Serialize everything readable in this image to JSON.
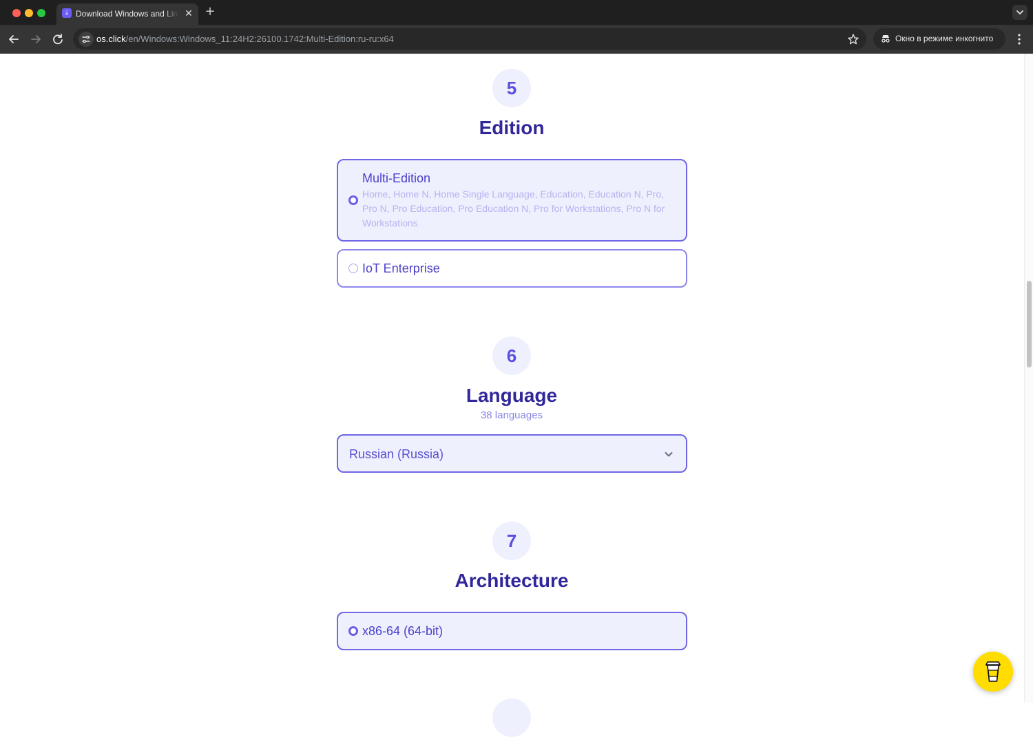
{
  "browser": {
    "tab_title": "Download Windows and Linux",
    "tab_favicon": "download-icon",
    "url_host": "os.click",
    "url_path": "/en/Windows:Windows_11:24H2:26100.1742:Multi-Edition:ru-ru:x64",
    "incognito_label": "Окно в режиме инкогнито",
    "traffic_colors": [
      "#ff5f57",
      "#febc2e",
      "#28c840"
    ]
  },
  "sections": {
    "edition": {
      "step": "5",
      "title": "Edition",
      "options": [
        {
          "title": "Multi-Edition",
          "description": "Home, Home N, Home Single Language, Education, Education N, Pro, Pro N, Pro Education, Pro Education N, Pro for Workstations, Pro N for Workstations",
          "selected": true
        },
        {
          "title": "IoT Enterprise",
          "selected": false
        }
      ]
    },
    "language": {
      "step": "6",
      "title": "Language",
      "subtitle": "38 languages",
      "selected_value": "Russian (Russia)"
    },
    "architecture": {
      "step": "7",
      "title": "Architecture",
      "options": [
        {
          "title": "x86-64 (64-bit)",
          "selected": true
        }
      ]
    }
  },
  "colors": {
    "accent": "#6a5fe6",
    "heading": "#31279a",
    "selected_bg": "#eef0fe",
    "coffee_button": "#ffdd00"
  }
}
